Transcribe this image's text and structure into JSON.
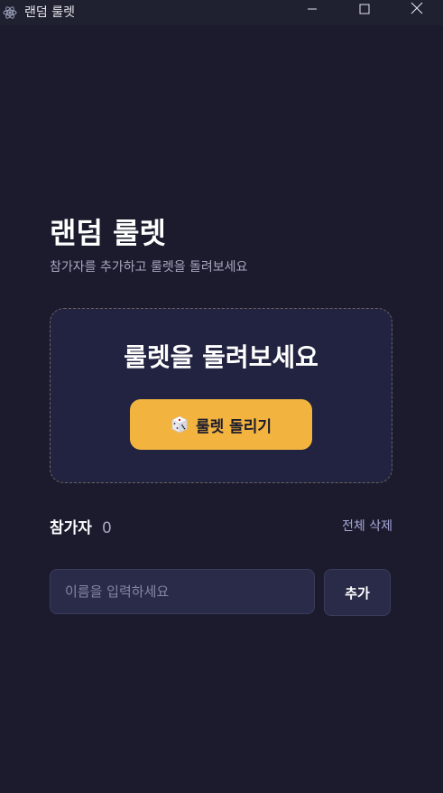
{
  "window": {
    "title": "랜덤 룰렛",
    "icons": {
      "app": "atom-icon",
      "minimize": "minimize-icon",
      "maximize": "maximize-icon",
      "close": "close-icon"
    }
  },
  "header": {
    "title": "랜덤 룰렛",
    "subtitle": "참가자를 추가하고 룰렛을 돌려보세요"
  },
  "roulette": {
    "heading": "룰렛을 돌려보세요",
    "spin_label": "룰렛 돌리기",
    "spin_icon": "dice-icon"
  },
  "participants": {
    "label": "참가자",
    "count": "0",
    "clear_all_label": "전체 삭제"
  },
  "add_form": {
    "placeholder": "이름을 입력하세요",
    "value": "",
    "add_label": "추가"
  },
  "colors": {
    "background": "#1b1b2d",
    "titlebar": "#1f2030",
    "card": "#222340",
    "accent": "#f3b43f",
    "muted_text": "#a7a8c0",
    "input_bg": "#2a2b48"
  }
}
